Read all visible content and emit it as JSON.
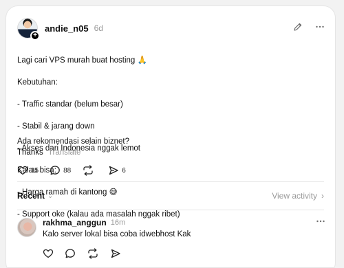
{
  "post": {
    "username": "andie_n05",
    "time_ago": "6d",
    "follow_badge": "+",
    "edit_icon": "pencil-icon",
    "more_icon": "ellipsis-icon",
    "body_lines": [
      "Lagi cari VPS murah buat hosting 🙏",
      "Kebutuhan:",
      "- Traffic standar (belum besar)",
      "- Stabil & jarang down",
      "- Akses dari Indonesia nggak lemot",
      "Kalau bisa:",
      "- Harga ramah di kantong 😅",
      "- Support oke (kalau ada masalah nggak ribet)"
    ],
    "body_after_lines": [
      "Ada rekomendasi selain biznet?",
      "Thanks"
    ],
    "translate_label": "Translate",
    "likes": "15",
    "comments": "88",
    "shares": "6"
  },
  "activity": {
    "recent_label": "Recent",
    "recent_chevron": "⌄",
    "view_activity_label": "View activity",
    "view_activity_chevron": "›"
  },
  "reply": {
    "username": "rakhma_anggun",
    "time_ago": "16m",
    "text": "Kalo server lokal bisa coba idwebhost Kak",
    "more_icon": "ellipsis-icon"
  },
  "colors": {
    "background": "#f2f2f2",
    "card": "#ffffff",
    "muted_text": "#9a9a9a",
    "text": "#101010"
  }
}
